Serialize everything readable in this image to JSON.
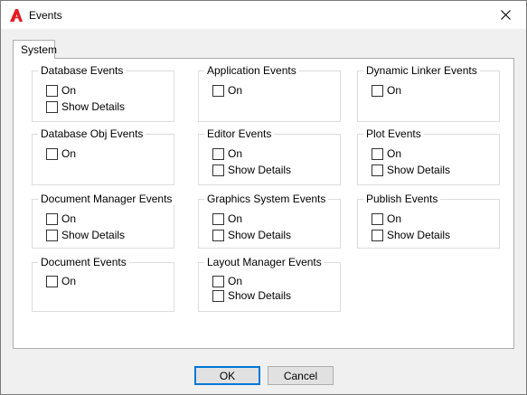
{
  "window": {
    "title": "Events"
  },
  "tabs": [
    {
      "label": "System"
    }
  ],
  "groups": {
    "database_events": {
      "title": "Database Events",
      "on": "On",
      "details": "Show Details"
    },
    "application_events": {
      "title": "Application Events",
      "on": "On"
    },
    "dynamic_linker_events": {
      "title": "Dynamic Linker Events",
      "on": "On"
    },
    "database_obj_events": {
      "title": "Database Obj Events",
      "on": "On"
    },
    "editor_events": {
      "title": "Editor Events",
      "on": "On",
      "details": "Show Details"
    },
    "plot_events": {
      "title": "Plot Events",
      "on": "On",
      "details": "Show Details"
    },
    "document_manager_events": {
      "title": "Document Manager Events",
      "on": "On",
      "details": "Show Details"
    },
    "graphics_system_events": {
      "title": "Graphics System Events",
      "on": "On",
      "details": "Show Details"
    },
    "publish_events": {
      "title": "Publish Events",
      "on": "On",
      "details": "Show Details"
    },
    "document_events": {
      "title": "Document Events",
      "on": "On"
    },
    "layout_manager_events": {
      "title": "Layout Manager Events",
      "on": "On",
      "details": "Show Details"
    }
  },
  "buttons": {
    "ok": "OK",
    "cancel": "Cancel"
  },
  "icons": {
    "app": "autocad-logo-icon",
    "close": "close-icon"
  },
  "colors": {
    "app_logo": "#e31b23",
    "focus_border": "#0078d7",
    "dialog_bg": "#f0f0f0"
  }
}
